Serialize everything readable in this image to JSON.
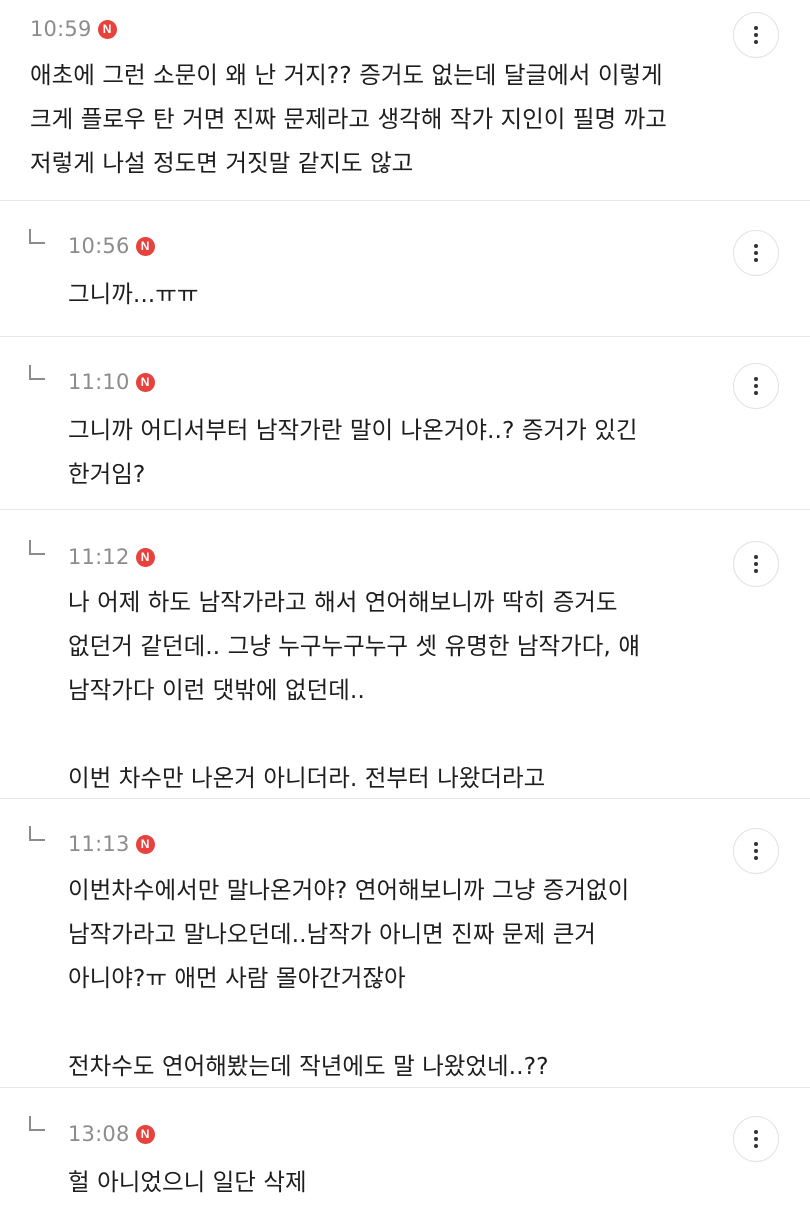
{
  "comments": [
    {
      "time": "10:59",
      "badge": "N",
      "text": "애초에 그런 소문이 왜 난 거지?? 증거도 없는데 달글에서 이렇게\n크게 플로우 탄 거면 진짜 문제라고 생각해 작가 지인이 필명 까고\n저렇게 나설 정도면 거짓말 같지도 않고",
      "is_reply": false
    },
    {
      "time": "10:56",
      "badge": "N",
      "text": "그니까...ㅠㅠ",
      "is_reply": true
    },
    {
      "time": "11:10",
      "badge": "N",
      "text": "그니까 어디서부터 남작가란 말이 나온거야..? 증거가 있긴\n한거임?",
      "is_reply": true
    },
    {
      "time": "11:12",
      "badge": "N",
      "text": "나 어제 하도 남작가라고 해서 연어해보니까 딱히 증거도\n없던거 같던데.. 그냥 누구누구누구 셋 유명한 남작가다, 얘\n남작가다 이런 댓밖에 없던데..\n\n이번 차수만 나온거 아니더라. 전부터 나왔더라고",
      "is_reply": true
    },
    {
      "time": "11:13",
      "badge": "N",
      "text": "이번차수에서만 말나온거야? 연어해보니까 그냥 증거없이\n남작가라고 말나오던데..남작가 아니면 진짜 문제 큰거\n아니야?ㅠ 애먼 사람 몰아간거잖아\n\n전차수도 연어해봤는데 작년에도 말 나왔었네..??",
      "is_reply": true
    },
    {
      "time": "13:08",
      "badge": "N",
      "text": "헐 아니었으니 일단 삭제",
      "is_reply": true
    }
  ],
  "colors": {
    "badge": "#e8423f",
    "time": "#8c8c8c",
    "divider": "#e6e6e6"
  },
  "icons": {
    "reply": "reply-arrow-icon",
    "more": "more-vertical-icon",
    "new": "new-badge-icon"
  }
}
